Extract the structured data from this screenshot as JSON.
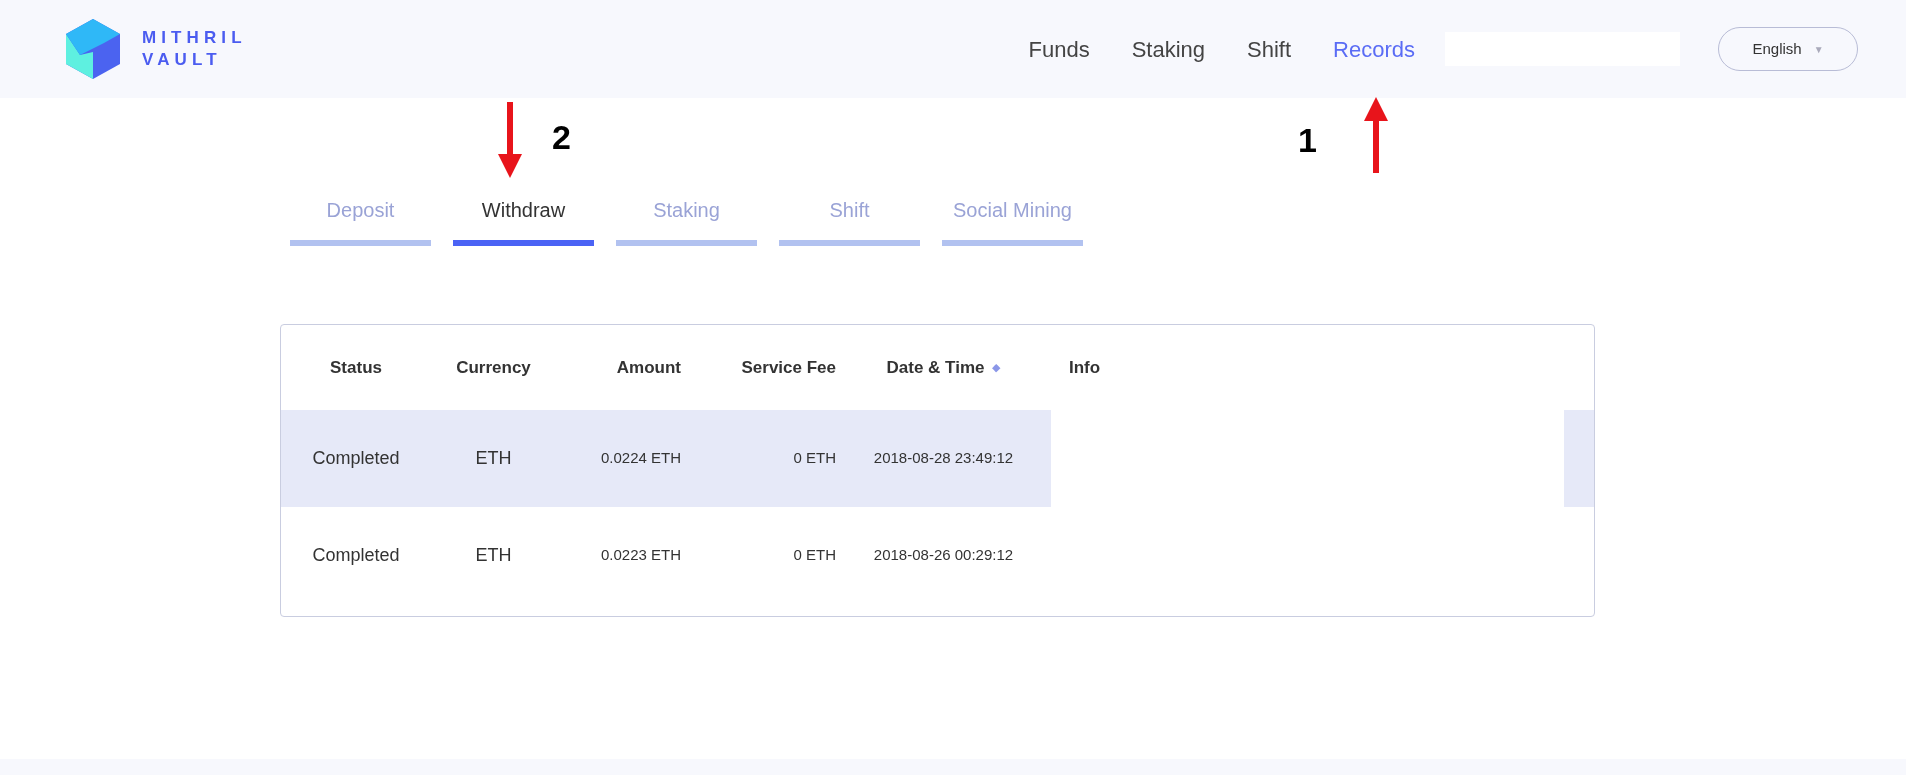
{
  "header": {
    "logo_line_1": "MITHRIL",
    "logo_line_2": "VAULT",
    "nav": [
      {
        "label": "Funds",
        "selected": false
      },
      {
        "label": "Staking",
        "selected": false
      },
      {
        "label": "Shift",
        "selected": false
      },
      {
        "label": "Records",
        "selected": true
      }
    ],
    "language": {
      "label": "English",
      "caret": "▼"
    }
  },
  "tabs": [
    {
      "label": "Deposit",
      "selected": false
    },
    {
      "label": "Withdraw",
      "selected": true
    },
    {
      "label": "Staking",
      "selected": false
    },
    {
      "label": "Shift",
      "selected": false
    },
    {
      "label": "Social Mining",
      "selected": false
    }
  ],
  "table": {
    "columns": [
      "Status",
      "Currency",
      "Amount",
      "Service Fee",
      "Date & Time",
      "Info"
    ],
    "sort_icon": "◆",
    "rows": [
      {
        "status": "Completed",
        "currency": "ETH",
        "amount": "0.0224 ETH",
        "service_fee": "0 ETH",
        "date_time": "2018-08-28 23:49:12",
        "selected": true
      },
      {
        "status": "Completed",
        "currency": "ETH",
        "amount": "0.0223 ETH",
        "service_fee": "0 ETH",
        "date_time": "2018-08-26 00:29:12",
        "selected": false
      }
    ]
  },
  "annotations": [
    {
      "label": "2",
      "kind": "down"
    },
    {
      "label": "1",
      "kind": "up"
    }
  ]
}
